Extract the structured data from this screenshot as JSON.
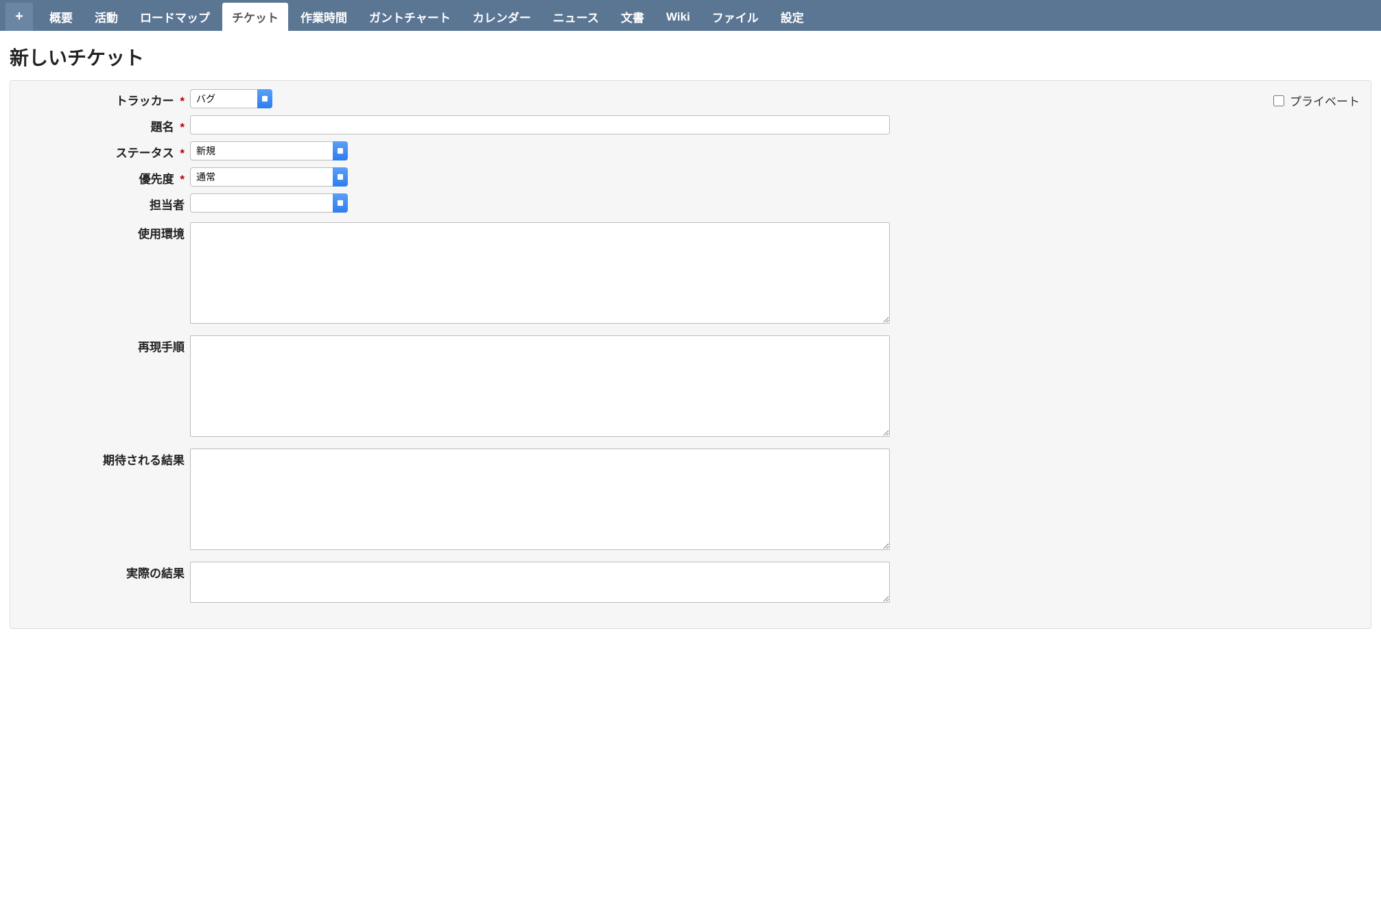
{
  "nav": {
    "plus_label": "+",
    "tabs": [
      {
        "label": "概要",
        "active": false
      },
      {
        "label": "活動",
        "active": false
      },
      {
        "label": "ロードマップ",
        "active": false
      },
      {
        "label": "チケット",
        "active": true
      },
      {
        "label": "作業時間",
        "active": false
      },
      {
        "label": "ガントチャート",
        "active": false
      },
      {
        "label": "カレンダー",
        "active": false
      },
      {
        "label": "ニュース",
        "active": false
      },
      {
        "label": "文書",
        "active": false
      },
      {
        "label": "Wiki",
        "active": false
      },
      {
        "label": "ファイル",
        "active": false
      },
      {
        "label": "設定",
        "active": false
      }
    ]
  },
  "page_title": "新しいチケット",
  "labels": {
    "tracker": "トラッカー",
    "subject": "題名",
    "status": "ステータス",
    "priority": "優先度",
    "assignee": "担当者",
    "env": "使用環境",
    "repro": "再現手順",
    "expected": "期待される結果",
    "actual": "実際の結果",
    "private": "プライベート",
    "required_mark": "*"
  },
  "values": {
    "tracker": "バグ",
    "subject": "",
    "status": "新規",
    "priority": "通常",
    "assignee": "",
    "env": "",
    "repro": "",
    "expected": "",
    "actual": "",
    "private_checked": false
  }
}
